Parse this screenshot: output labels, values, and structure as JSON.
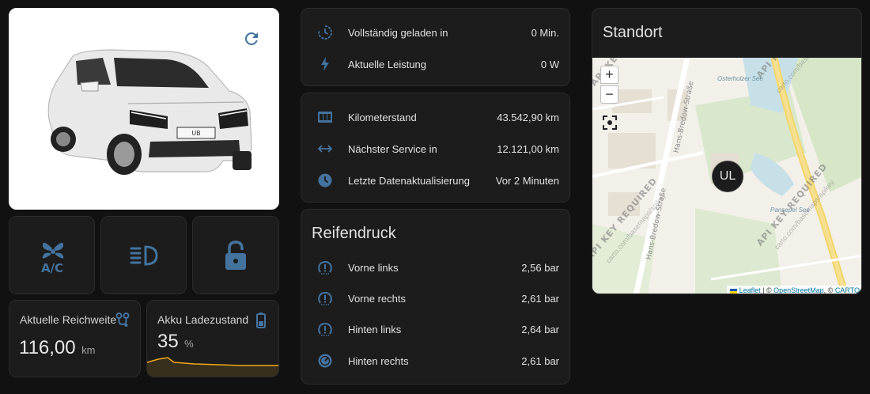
{
  "car": {
    "refresh_icon": "refresh-icon",
    "plate_text": "UB"
  },
  "controls": [
    {
      "icon": "fan-ac-icon",
      "label": "A/C"
    },
    {
      "icon": "headlight-icon"
    },
    {
      "icon": "lock-open-icon"
    }
  ],
  "range": {
    "title": "Aktuelle Reichweite",
    "value": "116,00",
    "unit": "km",
    "icon": "map-marker-distance-icon"
  },
  "battery": {
    "title": "Akku Ladezustand",
    "value": "35",
    "unit": "%",
    "icon": "battery-icon",
    "accent": "#f2a91d"
  },
  "charging": [
    {
      "icon": "clock-charge-icon",
      "label": "Vollständig geladen in",
      "value": "0 Min."
    },
    {
      "icon": "lightning-icon",
      "label": "Aktuelle Leistung",
      "value": "0 W"
    }
  ],
  "vehicle": [
    {
      "icon": "odometer-icon",
      "label": "Kilometerstand",
      "value": "43.542,90 km"
    },
    {
      "icon": "arrow-left-right-icon",
      "label": "Nächster Service in",
      "value": "12.121,00 km"
    },
    {
      "icon": "clock-icon",
      "label": "Letzte Datenaktualisierung",
      "value": "Vor 2 Minuten"
    }
  ],
  "tires": {
    "title": "Reifendruck",
    "rows": [
      {
        "icon": "tire-alert-icon",
        "label": "Vorne links",
        "value": "2,56 bar"
      },
      {
        "icon": "tire-alert-icon",
        "label": "Vorne rechts",
        "value": "2,61 bar"
      },
      {
        "icon": "tire-alert-icon",
        "label": "Hinten links",
        "value": "2,64 bar"
      },
      {
        "icon": "gauge-icon",
        "label": "Hinten rechts",
        "value": "2,61 bar"
      }
    ]
  },
  "location": {
    "title": "Standort",
    "zoom_in": "+",
    "zoom_out": "−",
    "marker": "UL",
    "street_1": "Hans-Bredow-Straße",
    "street_2": "Hans-Bredow-Straße",
    "lake_1": "Osterholzer See",
    "lake_2": "Pansepel See",
    "watermark": "API KEY REQUIRED",
    "watermark_url": "carto.com/basemaps/apikey",
    "attrib_leaflet": "Leaflet",
    "attrib_sep1": " | © ",
    "attrib_osm": "OpenStreetMap",
    "attrib_sep2": ", © ",
    "attrib_carto": "CARTO"
  },
  "colors": {
    "icon_blue": "#44739e",
    "card_bg": "#1c1c1c",
    "page_bg": "#111111"
  }
}
